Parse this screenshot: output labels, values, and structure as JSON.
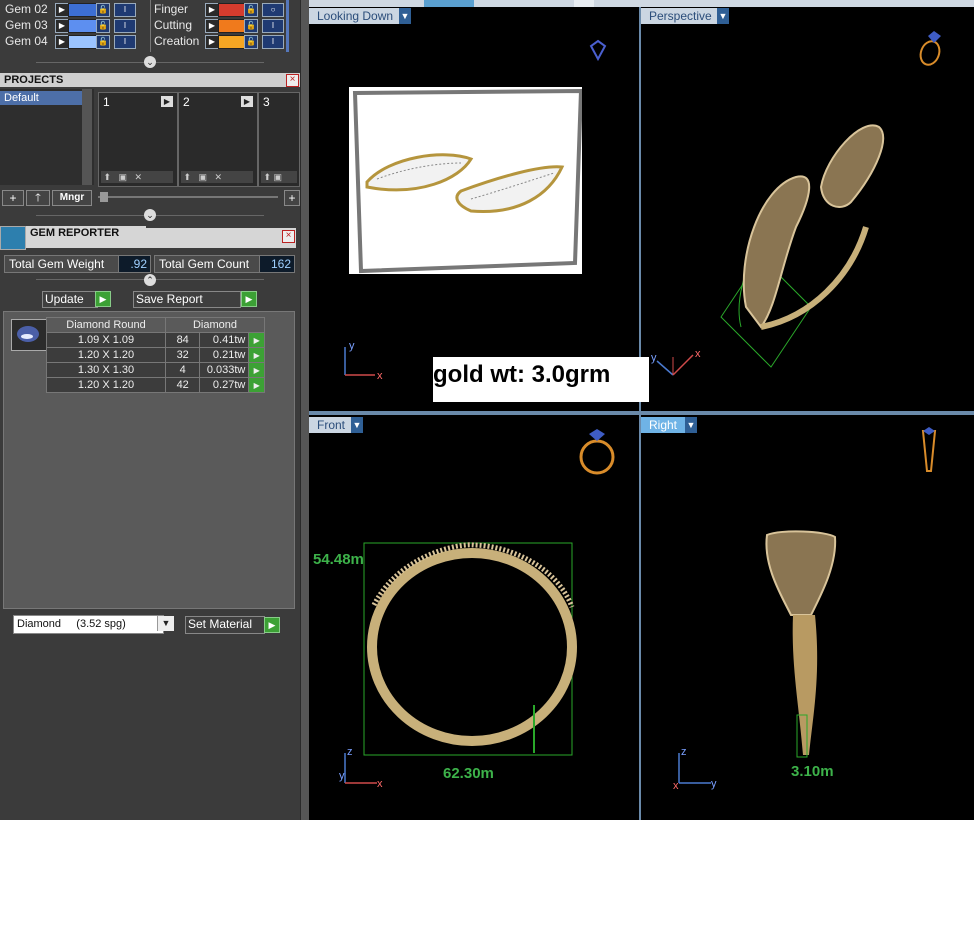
{
  "materials": {
    "rows": [
      {
        "gem": "Gem 02",
        "gem_color": "#3d6fd3",
        "mat": "Finger",
        "mat_color": "#d43c2e"
      },
      {
        "gem": "Gem 03",
        "gem_color": "#5d8ff0",
        "mat": "Cutting",
        "mat_color": "#f07a1c"
      },
      {
        "gem": "Gem 04",
        "gem_color": "#9bc4ff",
        "mat": "Creation",
        "mat_color": "#f5a623"
      }
    ]
  },
  "projects": {
    "title": "PROJECTS",
    "list": [
      "Default"
    ],
    "slots": [
      "1",
      "2",
      "3"
    ],
    "manager_label": "Mngr"
  },
  "gem_reporter": {
    "title": "GEM REPORTER",
    "total_weight_label": "Total Gem Weight",
    "total_weight_value": ".92",
    "total_count_label": "Total Gem Count",
    "total_count_value": "162",
    "update_label": "Update",
    "save_report_label": "Save Report",
    "table_headers": [
      "Diamond Round",
      "Diamond"
    ],
    "rows": [
      {
        "size": "1.09 X 1.09",
        "count": "84",
        "weight": "0.41tw"
      },
      {
        "size": "1.20 X 1.20",
        "count": "32",
        "weight": "0.21tw"
      },
      {
        "size": "1.30 X 1.30",
        "count": "4",
        "weight": "0.033tw"
      },
      {
        "size": "1.20 X 1.20",
        "count": "42",
        "weight": "0.27tw"
      }
    ],
    "material_select": "Diamond     (3.52 spg)",
    "set_material_label": "Set Material"
  },
  "viewports": {
    "top_left": "Looking Down",
    "top_right": "Perspective",
    "bottom_left": "Front",
    "bottom_right": "Right"
  },
  "annotations": {
    "gold_weight": "gold wt: 3.0grm",
    "height_dim": "54.48m",
    "width_dim": "62.30m",
    "thickness_dim": "3.10m"
  },
  "axes": {
    "x": "x",
    "y": "y",
    "z": "z"
  },
  "colors": {
    "accent_green": "#3db24a",
    "gold": "#c8b07a",
    "viewport_bg": "#000000"
  }
}
